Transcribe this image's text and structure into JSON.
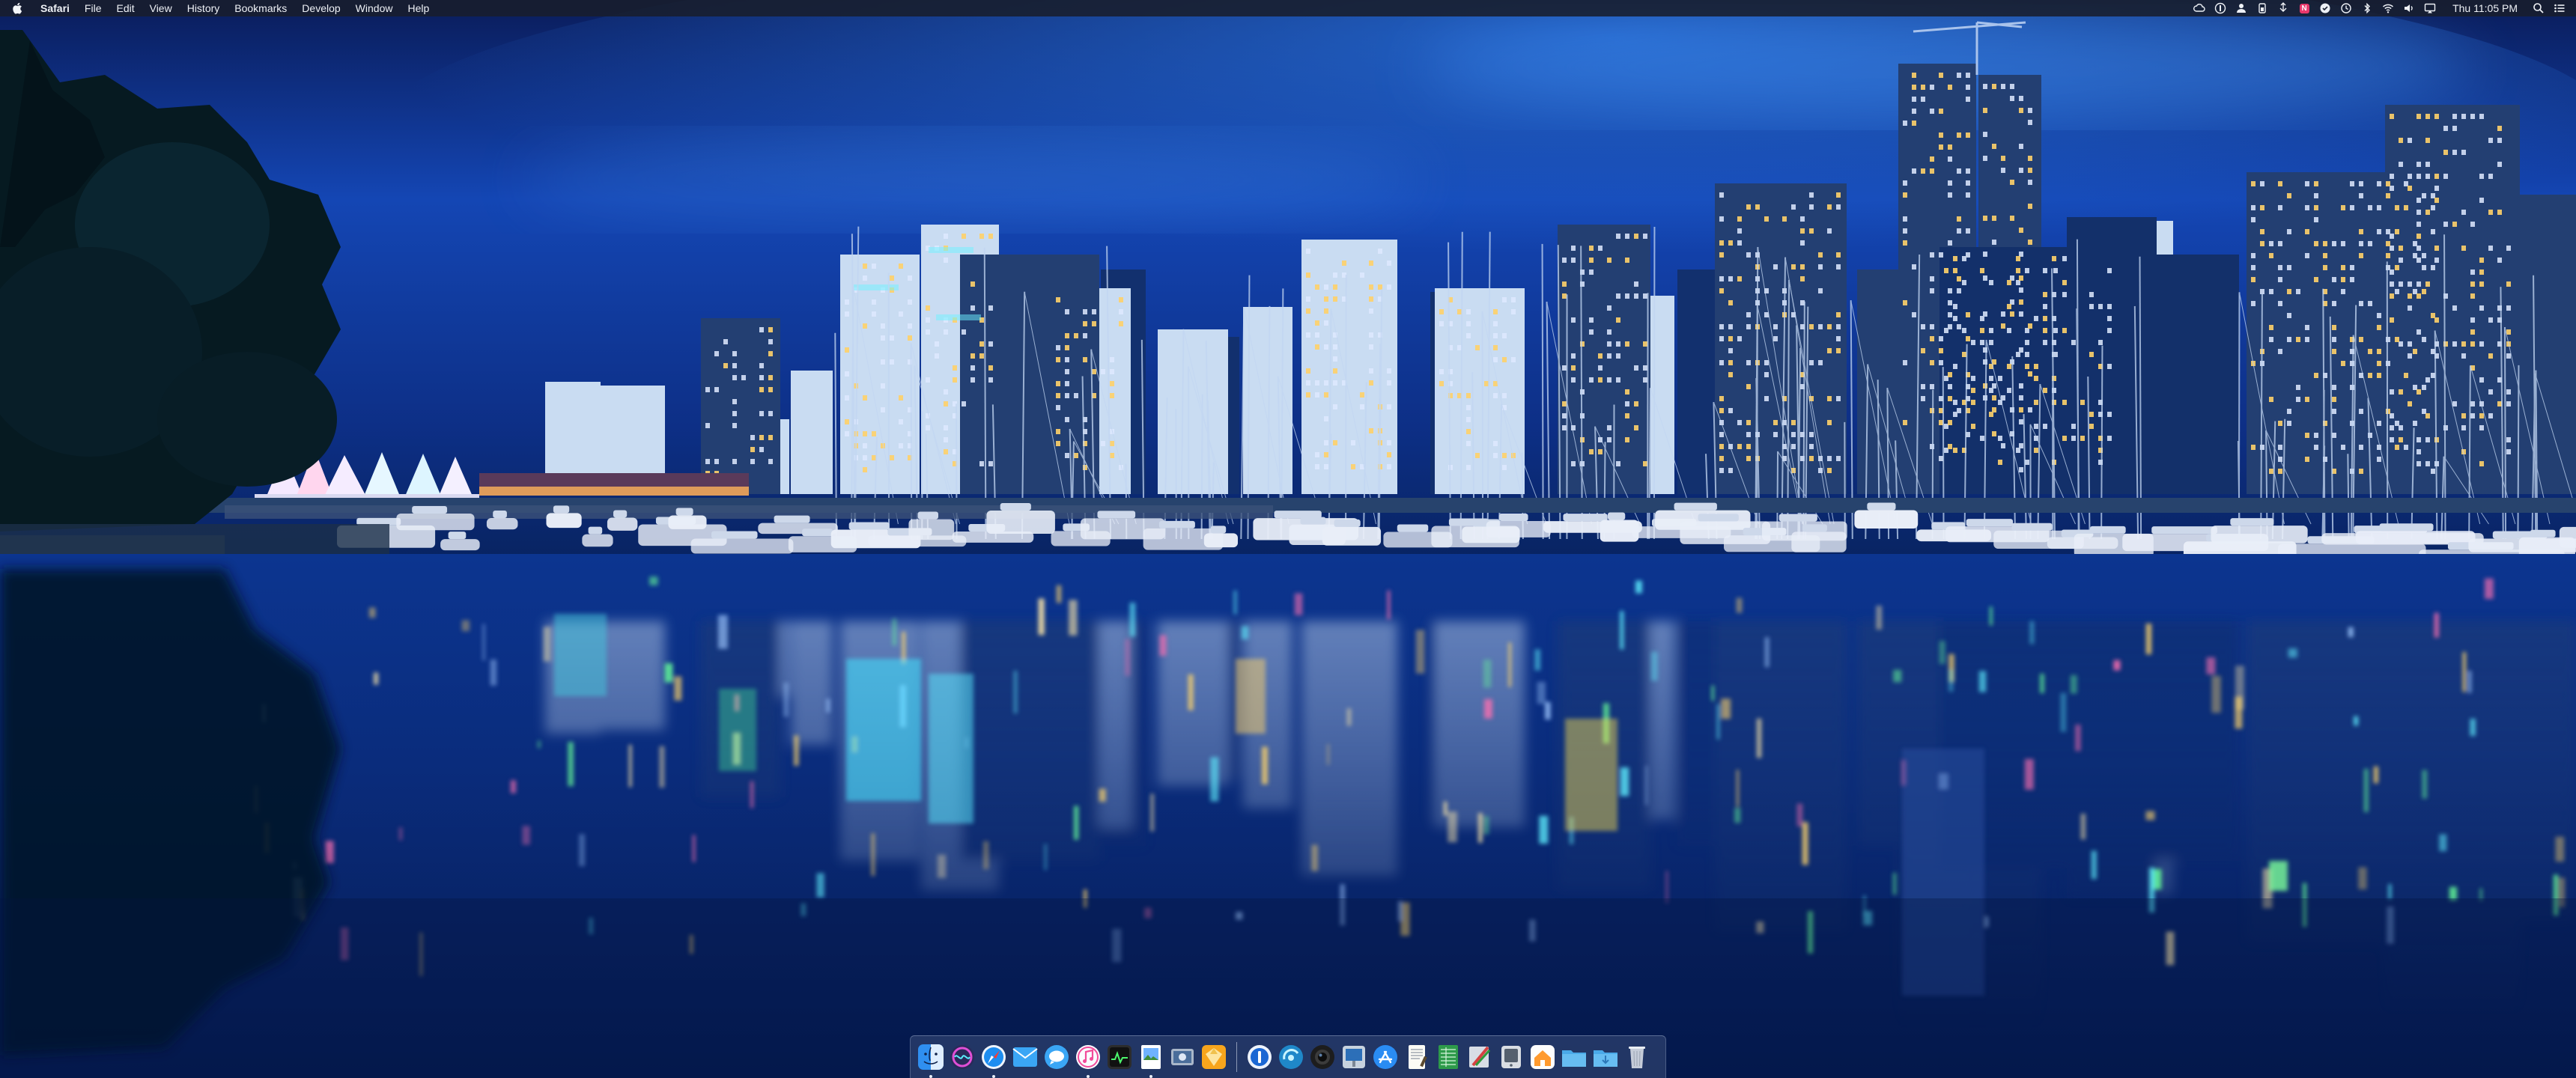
{
  "menubar": {
    "app_name": "Safari",
    "menus": [
      "File",
      "Edit",
      "View",
      "History",
      "Bookmarks",
      "Develop",
      "Window",
      "Help"
    ],
    "clock": "Thu 11:05 PM",
    "badge_letter": "N"
  },
  "dock": {
    "apps": [
      "finder",
      "siri",
      "safari",
      "mail",
      "messages",
      "itunes",
      "activity-monitor",
      "preview",
      "image-capture",
      "sketch",
      "1password",
      "cleanmymac",
      "camera",
      "photo-booth",
      "app-store",
      "textedit",
      "spreadsheet",
      "script-editor",
      "system-info",
      "home",
      "folder",
      "downloads-folder",
      "trash"
    ],
    "running": [
      "finder",
      "safari",
      "itunes",
      "preview"
    ]
  },
  "colors": {
    "sky_top": "#081a55",
    "sky_mid": "#123b9e",
    "water": "#0a2f82",
    "menubar_bg": "#181e2c",
    "accent_teal": "#39e7ff",
    "accent_gold": "#ffd56a"
  }
}
